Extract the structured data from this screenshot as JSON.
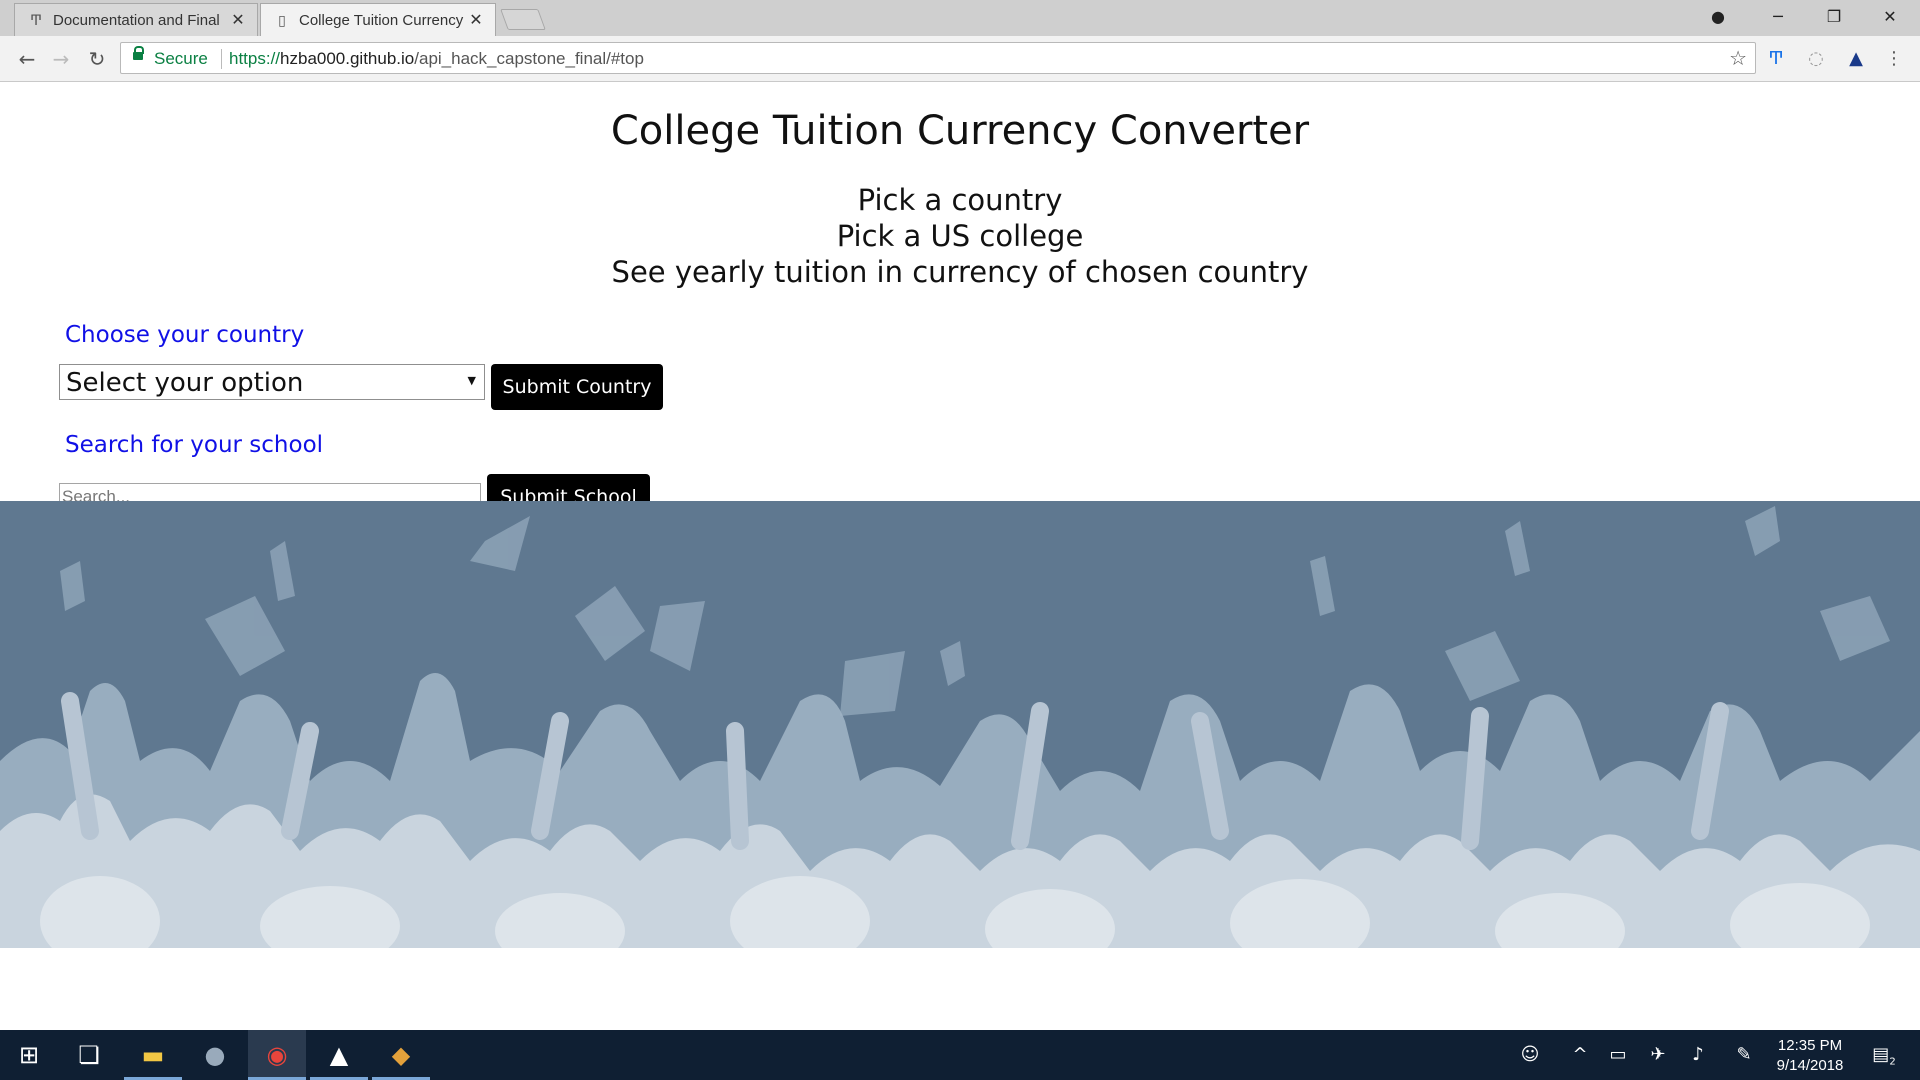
{
  "browser": {
    "tabs": [
      {
        "title": "Documentation and Final",
        "icon": "thinkful-icon",
        "close": "✕"
      },
      {
        "title": "College Tuition Currency",
        "icon": "page-icon",
        "close": "✕"
      }
    ],
    "secure_label": "Secure",
    "url_proto": "https://",
    "url_host": "hzba000.github.io",
    "url_path": "/api_hack_capstone_final/#top",
    "window_controls": {
      "minimize": "─",
      "maximize": "❐",
      "close": "✕"
    }
  },
  "page": {
    "title": "College Tuition Currency Converter",
    "steps": [
      "Pick a country",
      "Pick a US college",
      "See yearly tuition in currency of chosen country"
    ],
    "country_section": {
      "label": "Choose your country",
      "select_value": "Select your option",
      "submit_label": "Submit Country"
    },
    "school_section": {
      "label": "Search for your school",
      "search_placeholder": "Search...",
      "submit_label": "Submit School"
    },
    "hero_image": "graduation-caps-silhouette",
    "colors": {
      "label_blue": "#1010e6",
      "hero_bg": "#5f7890",
      "button_bg": "#000000"
    }
  },
  "taskbar": {
    "apps": [
      "windows-start-icon",
      "task-view-icon",
      "file-explorer-icon",
      "globe-app-icon",
      "chrome-icon",
      "photos-icon",
      "git-icon"
    ],
    "time": "12:35 PM",
    "date": "9/14/2018",
    "notification_count": "2"
  }
}
